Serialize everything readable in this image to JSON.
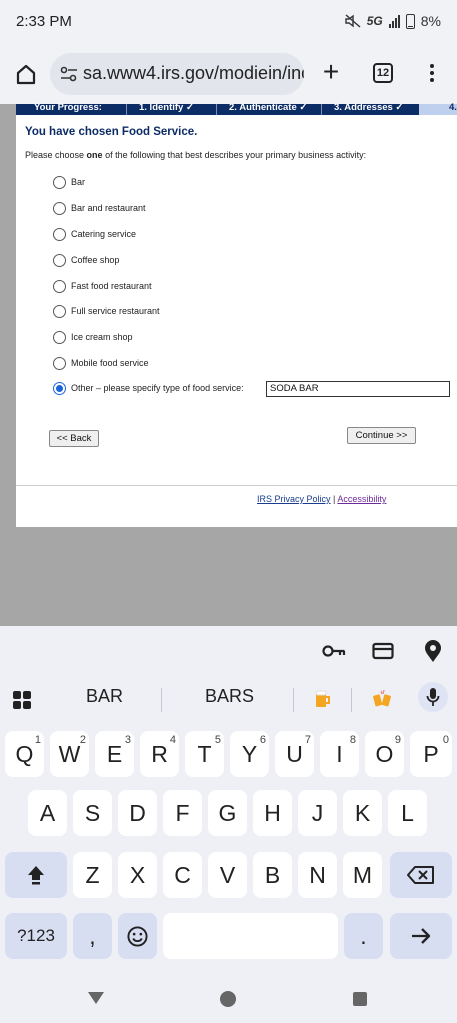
{
  "status_bar": {
    "time": "2:33 PM",
    "network": "5G",
    "battery": "8%"
  },
  "browser": {
    "url": "sa.www4.irs.gov/modiein/ind",
    "tab_count": "12"
  },
  "progress": {
    "label": "Your Progress:",
    "steps": [
      "1. Identify ✓",
      "2. Authenticate ✓",
      "3. Addresses ✓",
      "4."
    ]
  },
  "page": {
    "title": "You have chosen Food Service.",
    "instruction_before": "Please choose ",
    "instruction_bold": "one",
    "instruction_after": " of the following that best describes your primary business activity:",
    "options": [
      "Bar",
      "Bar and restaurant",
      "Catering service",
      "Coffee shop",
      "Fast food restaurant",
      "Full service restaurant",
      "Ice cream shop",
      "Mobile food service",
      "Other – please specify type of food service:"
    ],
    "selected_option": "Other – please specify type of food service:",
    "other_value": "SODA BAR",
    "back_label": "<< Back",
    "continue_label": "Continue >>",
    "privacy_link": "IRS Privacy Policy",
    "footer_sep": "|",
    "accessibility_link": "Accessibility"
  },
  "keyboard": {
    "suggestions": [
      "BAR",
      "BARS"
    ],
    "row1": [
      "Q",
      "W",
      "E",
      "R",
      "T",
      "Y",
      "U",
      "I",
      "O",
      "P"
    ],
    "row1_hints": [
      "1",
      "2",
      "3",
      "4",
      "5",
      "6",
      "7",
      "8",
      "9",
      "0"
    ],
    "row2": [
      "A",
      "S",
      "D",
      "F",
      "G",
      "H",
      "J",
      "K",
      "L"
    ],
    "row3": [
      "Z",
      "X",
      "C",
      "V",
      "B",
      "N",
      "M"
    ],
    "symbols_label": "?123",
    "comma": ",",
    "period": "."
  },
  "icons": [
    "home-icon",
    "tune-icon",
    "new-tab-icon",
    "tabs-icon",
    "menu-icon",
    "key-icon",
    "card-icon",
    "location-icon",
    "apps-icon",
    "beer-emoji-icon",
    "cheers-emoji-icon",
    "mic-icon",
    "shift-icon",
    "backspace-icon",
    "emoji-icon",
    "enter-icon",
    "back-nav-icon",
    "home-nav-icon",
    "recents-nav-icon"
  ],
  "colors": {
    "irs_navy": "#0c2c66",
    "radio_blue": "#1a66d9",
    "keyboard_bg": "#eef0f6"
  }
}
